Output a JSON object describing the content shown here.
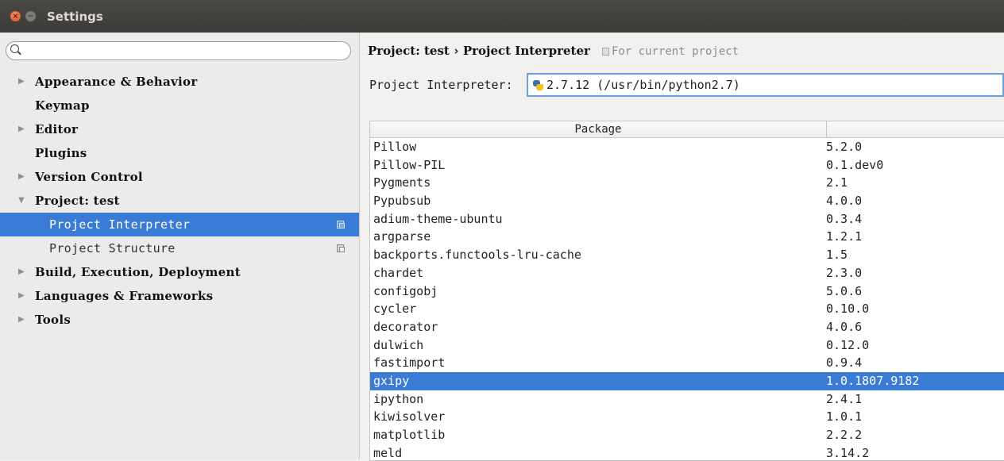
{
  "window": {
    "title": "Settings"
  },
  "sidebar": {
    "search": {
      "value": "",
      "placeholder": ""
    },
    "items": [
      {
        "label": "Appearance & Behavior",
        "arrow": "▶",
        "level": 0
      },
      {
        "label": "Keymap",
        "arrow": "",
        "level": 0
      },
      {
        "label": "Editor",
        "arrow": "▶",
        "level": 0
      },
      {
        "label": "Plugins",
        "arrow": "",
        "level": 0
      },
      {
        "label": "Version Control",
        "arrow": "▶",
        "level": 0
      },
      {
        "label": "Project: test",
        "arrow": "▼",
        "level": 0
      },
      {
        "label": "Project Interpreter",
        "arrow": "",
        "level": 1,
        "selected": true
      },
      {
        "label": "Project Structure",
        "arrow": "",
        "level": 1
      },
      {
        "label": "Build, Execution, Deployment",
        "arrow": "▶",
        "level": 0
      },
      {
        "label": "Languages & Frameworks",
        "arrow": "▶",
        "level": 0
      },
      {
        "label": "Tools",
        "arrow": "▶",
        "level": 0
      }
    ]
  },
  "main": {
    "breadcrumb": {
      "parent": "Project: test",
      "separator": "›",
      "current": "Project Interpreter",
      "note": "For current project"
    },
    "interpreter": {
      "label": "Project Interpreter:",
      "value": "2.7.12 (/usr/bin/python2.7)"
    },
    "table": {
      "headers": [
        "Package",
        ""
      ],
      "rows": [
        {
          "package": "Pillow",
          "version": "5.2.0"
        },
        {
          "package": "Pillow-PIL",
          "version": "0.1.dev0"
        },
        {
          "package": "Pygments",
          "version": "2.1"
        },
        {
          "package": "Pypubsub",
          "version": "4.0.0"
        },
        {
          "package": "adium-theme-ubuntu",
          "version": "0.3.4"
        },
        {
          "package": "argparse",
          "version": "1.2.1"
        },
        {
          "package": "backports.functools-lru-cache",
          "version": "1.5"
        },
        {
          "package": "chardet",
          "version": "2.3.0"
        },
        {
          "package": "configobj",
          "version": "5.0.6"
        },
        {
          "package": "cycler",
          "version": "0.10.0"
        },
        {
          "package": "decorator",
          "version": "4.0.6"
        },
        {
          "package": "dulwich",
          "version": "0.12.0"
        },
        {
          "package": "fastimport",
          "version": "0.9.4"
        },
        {
          "package": "gxipy",
          "version": "1.0.1807.9182",
          "selected": true
        },
        {
          "package": "ipython",
          "version": "2.4.1"
        },
        {
          "package": "kiwisolver",
          "version": "1.0.1"
        },
        {
          "package": "matplotlib",
          "version": "2.2.2"
        },
        {
          "package": "meld",
          "version": "3.14.2"
        }
      ]
    }
  },
  "colors": {
    "selection": "#3a7bd5",
    "titlebar": "#3c3b37",
    "close_button": "#e0501f"
  }
}
